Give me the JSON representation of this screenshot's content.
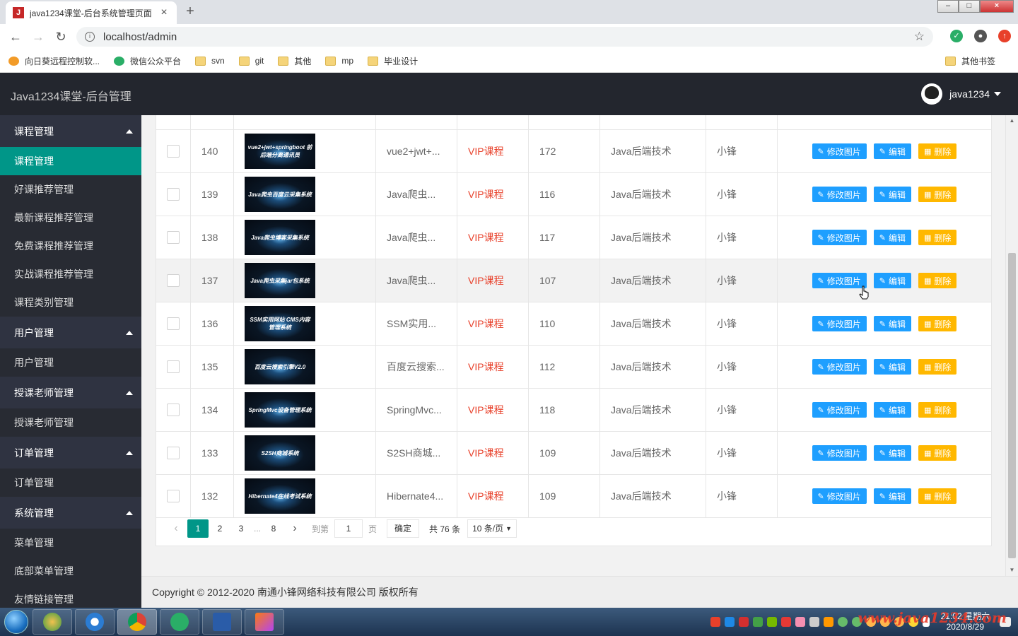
{
  "browser": {
    "tab_title": "java1234课堂-后台系统管理页面",
    "tab_favicon": "J",
    "url": "localhost/admin",
    "bookmarks": [
      "向日葵远程控制软...",
      "微信公众平台",
      "svn",
      "git",
      "其他",
      "mp",
      "毕业设计"
    ],
    "other_bookmarks": "其他书签"
  },
  "header": {
    "title": "Java1234课堂-后台管理",
    "user": "java1234"
  },
  "sidebar": {
    "groups": [
      {
        "label": "课程管理",
        "items": [
          {
            "label": "课程管理",
            "active": true
          },
          {
            "label": "好课推荐管理"
          },
          {
            "label": "最新课程推荐管理"
          },
          {
            "label": "免费课程推荐管理"
          },
          {
            "label": "实战课程推荐管理"
          },
          {
            "label": "课程类别管理"
          }
        ]
      },
      {
        "label": "用户管理",
        "items": [
          {
            "label": "用户管理"
          }
        ]
      },
      {
        "label": "授课老师管理",
        "items": [
          {
            "label": "授课老师管理"
          }
        ]
      },
      {
        "label": "订单管理",
        "items": [
          {
            "label": "订单管理"
          }
        ]
      },
      {
        "label": "系统管理",
        "items": [
          {
            "label": "菜单管理"
          },
          {
            "label": "底部菜单管理"
          },
          {
            "label": "友情链接管理"
          }
        ]
      }
    ]
  },
  "table": {
    "rows": [
      {
        "id": "140",
        "thumb": "vue2+jwt+springboot\n前后端分离通讯员",
        "name": "vue2+jwt+...",
        "type": "VIP课程",
        "views": "172",
        "category": "Java后端技术",
        "teacher": "小锋"
      },
      {
        "id": "139",
        "thumb": "Java爬虫百度云采集系统",
        "name": "Java爬虫...",
        "type": "VIP课程",
        "views": "116",
        "category": "Java后端技术",
        "teacher": "小锋"
      },
      {
        "id": "138",
        "thumb": "Java爬虫博客采集系统",
        "name": "Java爬虫...",
        "type": "VIP课程",
        "views": "117",
        "category": "Java后端技术",
        "teacher": "小锋"
      },
      {
        "id": "137",
        "thumb": "Java爬虫采集jar包系统",
        "name": "Java爬虫...",
        "type": "VIP课程",
        "views": "107",
        "category": "Java后端技术",
        "teacher": "小锋",
        "hover": true
      },
      {
        "id": "136",
        "thumb": "SSM实用网站\nCMS内容管理系统",
        "name": "SSM实用...",
        "type": "VIP课程",
        "views": "110",
        "category": "Java后端技术",
        "teacher": "小锋"
      },
      {
        "id": "135",
        "thumb": "百度云搜索引擎V2.0",
        "name": "百度云搜索...",
        "type": "VIP课程",
        "views": "112",
        "category": "Java后端技术",
        "teacher": "小锋"
      },
      {
        "id": "134",
        "thumb": "SpringMvc设备管理系统",
        "name": "SpringMvc...",
        "type": "VIP课程",
        "views": "118",
        "category": "Java后端技术",
        "teacher": "小锋"
      },
      {
        "id": "133",
        "thumb": "S2SH商城系统",
        "name": "S2SH商城...",
        "type": "VIP课程",
        "views": "109",
        "category": "Java后端技术",
        "teacher": "小锋"
      },
      {
        "id": "132",
        "thumb": "Hibernate4在线考试系统",
        "name": "Hibernate4...",
        "type": "VIP课程",
        "views": "109",
        "category": "Java后端技术",
        "teacher": "小锋"
      }
    ],
    "actions": {
      "edit_image": "修改图片",
      "edit": "编辑",
      "delete": "删除"
    }
  },
  "pagination": {
    "pages": [
      "1",
      "2",
      "3",
      "8"
    ],
    "ellipsis": "...",
    "current": "1",
    "goto_label": "到第",
    "goto_value": "1",
    "page_unit": "页",
    "confirm": "确定",
    "total": "共 76 条",
    "page_size": "10 条/页"
  },
  "footer": {
    "copyright": "Copyright © 2012-2020 南通小锋网络科技有限公司 版权所有"
  },
  "taskbar": {
    "time": "21:02 星期六",
    "date": "2020/8/29",
    "watermark": "www.java1234.com"
  },
  "colors": {
    "sidebar_active": "#009688",
    "primary_button": "#1e9fff",
    "warn_button": "#ffb800",
    "vip_text": "#e8402a",
    "header_bg": "#23262e"
  }
}
